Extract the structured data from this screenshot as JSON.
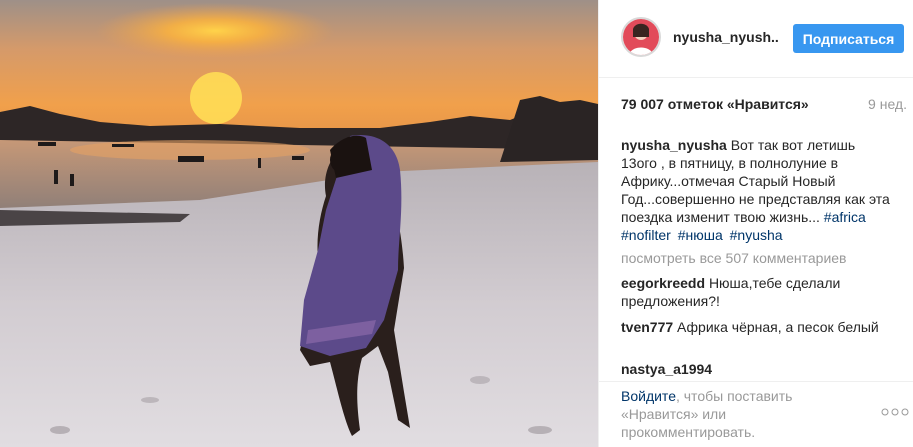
{
  "header": {
    "username": "nyusha_nyush..",
    "follow_label": "Подписаться"
  },
  "post": {
    "likes": "79 007 отметок «Нравится»",
    "age": "9 нед.",
    "caption_user": "nyusha_nyusha",
    "caption_text": "Вот так вот летишь 13ого , в пятницу, в полнолуние в Африку...отмечая Старый Новый Год...совершенно не представляя как эта поездка изменит твою жизнь...",
    "hashtags": [
      "#africa",
      "#nofilter",
      "#нюша",
      "#nyusha"
    ],
    "view_all_comments": "посмотреть все 507 комментариев"
  },
  "comments": [
    {
      "user": "eegorkreedd",
      "text": "Нюша,тебе сделали предложения?!"
    },
    {
      "user": "tven777",
      "text": "Африка чёрная, а песок белый"
    },
    {
      "user": "nastya_a1994",
      "text": ""
    }
  ],
  "footer": {
    "login_link": "Войдите",
    "login_text": ", чтобы поставить «Нравится» или прокомментировать."
  },
  "icons": {
    "more": "more-options-icon"
  },
  "colors": {
    "accent": "#3897f0",
    "link": "#003569",
    "muted": "#999999",
    "text": "#262626"
  }
}
